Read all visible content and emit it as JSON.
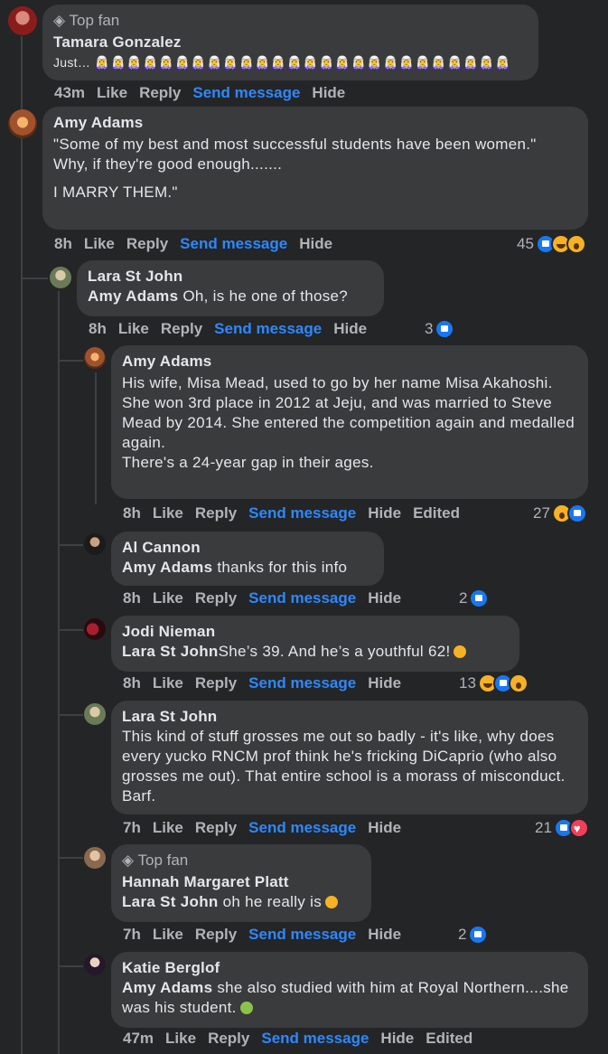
{
  "comments": [
    {
      "badge": "Top fan",
      "author": "Tamara Gonzalez",
      "text": "Just… 🧝‍♀️🧝‍♀️🧝‍♀️🧝‍♀️🧝‍♀️🧝‍♀️🧝‍♀️🧝‍♀️🧝‍♀️🧝‍♀️🧝‍♀️🧝‍♀️🧝‍♀️🧝‍♀️🧝‍♀️🧝‍♀️🧝‍♀️🧝‍♀️🧝‍♀️🧝‍♀️🧝‍♀️🧝‍♀️🧝‍♀️🧝‍♀️🧝‍♀️🧝‍♀️",
      "time": "43m"
    },
    {
      "author": "Amy Adams",
      "line1": "\"Some of my best and most successful students have been women.\"",
      "line2": "Why, if they're good enough.......",
      "line3": "I MARRY THEM.\"",
      "time": "8h",
      "reaction_count": "45"
    },
    {
      "author": "Lara St John",
      "mention": "Amy Adams",
      "text": " Oh, is he one of those?",
      "time": "8h",
      "reaction_count": "3"
    },
    {
      "author": "Amy Adams",
      "text": "His wife, Misa Mead, used to go by her name Misa Akahoshi.\nShe won 3rd place in 2012 at Jeju, and was married to Steve Mead by 2014. She entered the competition again and medalled again.\nThere's a 24-year gap in their ages.",
      "time": "8h",
      "edited": "Edited",
      "reaction_count": "27"
    },
    {
      "author": "Al Cannon",
      "mention": "Amy Adams",
      "text": " thanks for this info",
      "time": "8h",
      "reaction_count": "2"
    },
    {
      "author": "Jodi Nieman",
      "mention": "Lara St John",
      "text": "She’s 39. And he’s a youthful 62!",
      "time": "8h",
      "reaction_count": "13"
    },
    {
      "author": "Lara St John",
      "text": "This kind of stuff grosses me out so badly - it's like, why does every yucko RNCM prof think he's fricking DiCaprio (who also grosses me out). That entire school is a morass of misconduct. Barf.",
      "time": "7h",
      "reaction_count": "21"
    },
    {
      "badge": "Top fan",
      "author": "Hannah Margaret Platt",
      "mention": "Lara St John",
      "text": " oh he really is",
      "time": "7h",
      "reaction_count": "2"
    },
    {
      "author": "Katie Berglof",
      "mention": "Amy Adams",
      "text": " she also studied with him at Royal Northern....she was his student.",
      "time": "47m",
      "edited": "Edited"
    }
  ],
  "actions": {
    "like": "Like",
    "reply": "Reply",
    "send": "Send message",
    "hide": "Hide"
  },
  "colors": {
    "background": "#242526",
    "bubble": "#3a3b3c",
    "link": "#2d88ff",
    "muted": "#b0b3b8"
  }
}
